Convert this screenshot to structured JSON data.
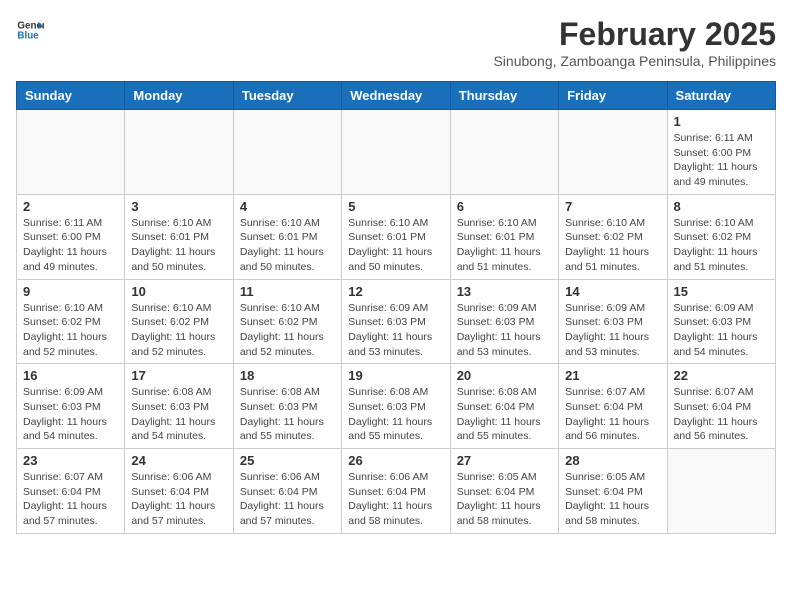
{
  "header": {
    "logo_line1": "General",
    "logo_line2": "Blue",
    "month_title": "February 2025",
    "subtitle": "Sinubong, Zamboanga Peninsula, Philippines"
  },
  "weekdays": [
    "Sunday",
    "Monday",
    "Tuesday",
    "Wednesday",
    "Thursday",
    "Friday",
    "Saturday"
  ],
  "weeks": [
    [
      {
        "day": "",
        "info": ""
      },
      {
        "day": "",
        "info": ""
      },
      {
        "day": "",
        "info": ""
      },
      {
        "day": "",
        "info": ""
      },
      {
        "day": "",
        "info": ""
      },
      {
        "day": "",
        "info": ""
      },
      {
        "day": "1",
        "info": "Sunrise: 6:11 AM\nSunset: 6:00 PM\nDaylight: 11 hours\nand 49 minutes."
      }
    ],
    [
      {
        "day": "2",
        "info": "Sunrise: 6:11 AM\nSunset: 6:00 PM\nDaylight: 11 hours\nand 49 minutes."
      },
      {
        "day": "3",
        "info": "Sunrise: 6:10 AM\nSunset: 6:01 PM\nDaylight: 11 hours\nand 50 minutes."
      },
      {
        "day": "4",
        "info": "Sunrise: 6:10 AM\nSunset: 6:01 PM\nDaylight: 11 hours\nand 50 minutes."
      },
      {
        "day": "5",
        "info": "Sunrise: 6:10 AM\nSunset: 6:01 PM\nDaylight: 11 hours\nand 50 minutes."
      },
      {
        "day": "6",
        "info": "Sunrise: 6:10 AM\nSunset: 6:01 PM\nDaylight: 11 hours\nand 51 minutes."
      },
      {
        "day": "7",
        "info": "Sunrise: 6:10 AM\nSunset: 6:02 PM\nDaylight: 11 hours\nand 51 minutes."
      },
      {
        "day": "8",
        "info": "Sunrise: 6:10 AM\nSunset: 6:02 PM\nDaylight: 11 hours\nand 51 minutes."
      }
    ],
    [
      {
        "day": "9",
        "info": "Sunrise: 6:10 AM\nSunset: 6:02 PM\nDaylight: 11 hours\nand 52 minutes."
      },
      {
        "day": "10",
        "info": "Sunrise: 6:10 AM\nSunset: 6:02 PM\nDaylight: 11 hours\nand 52 minutes."
      },
      {
        "day": "11",
        "info": "Sunrise: 6:10 AM\nSunset: 6:02 PM\nDaylight: 11 hours\nand 52 minutes."
      },
      {
        "day": "12",
        "info": "Sunrise: 6:09 AM\nSunset: 6:03 PM\nDaylight: 11 hours\nand 53 minutes."
      },
      {
        "day": "13",
        "info": "Sunrise: 6:09 AM\nSunset: 6:03 PM\nDaylight: 11 hours\nand 53 minutes."
      },
      {
        "day": "14",
        "info": "Sunrise: 6:09 AM\nSunset: 6:03 PM\nDaylight: 11 hours\nand 53 minutes."
      },
      {
        "day": "15",
        "info": "Sunrise: 6:09 AM\nSunset: 6:03 PM\nDaylight: 11 hours\nand 54 minutes."
      }
    ],
    [
      {
        "day": "16",
        "info": "Sunrise: 6:09 AM\nSunset: 6:03 PM\nDaylight: 11 hours\nand 54 minutes."
      },
      {
        "day": "17",
        "info": "Sunrise: 6:08 AM\nSunset: 6:03 PM\nDaylight: 11 hours\nand 54 minutes."
      },
      {
        "day": "18",
        "info": "Sunrise: 6:08 AM\nSunset: 6:03 PM\nDaylight: 11 hours\nand 55 minutes."
      },
      {
        "day": "19",
        "info": "Sunrise: 6:08 AM\nSunset: 6:03 PM\nDaylight: 11 hours\nand 55 minutes."
      },
      {
        "day": "20",
        "info": "Sunrise: 6:08 AM\nSunset: 6:04 PM\nDaylight: 11 hours\nand 55 minutes."
      },
      {
        "day": "21",
        "info": "Sunrise: 6:07 AM\nSunset: 6:04 PM\nDaylight: 11 hours\nand 56 minutes."
      },
      {
        "day": "22",
        "info": "Sunrise: 6:07 AM\nSunset: 6:04 PM\nDaylight: 11 hours\nand 56 minutes."
      }
    ],
    [
      {
        "day": "23",
        "info": "Sunrise: 6:07 AM\nSunset: 6:04 PM\nDaylight: 11 hours\nand 57 minutes."
      },
      {
        "day": "24",
        "info": "Sunrise: 6:06 AM\nSunset: 6:04 PM\nDaylight: 11 hours\nand 57 minutes."
      },
      {
        "day": "25",
        "info": "Sunrise: 6:06 AM\nSunset: 6:04 PM\nDaylight: 11 hours\nand 57 minutes."
      },
      {
        "day": "26",
        "info": "Sunrise: 6:06 AM\nSunset: 6:04 PM\nDaylight: 11 hours\nand 58 minutes."
      },
      {
        "day": "27",
        "info": "Sunrise: 6:05 AM\nSunset: 6:04 PM\nDaylight: 11 hours\nand 58 minutes."
      },
      {
        "day": "28",
        "info": "Sunrise: 6:05 AM\nSunset: 6:04 PM\nDaylight: 11 hours\nand 58 minutes."
      },
      {
        "day": "",
        "info": ""
      }
    ]
  ]
}
